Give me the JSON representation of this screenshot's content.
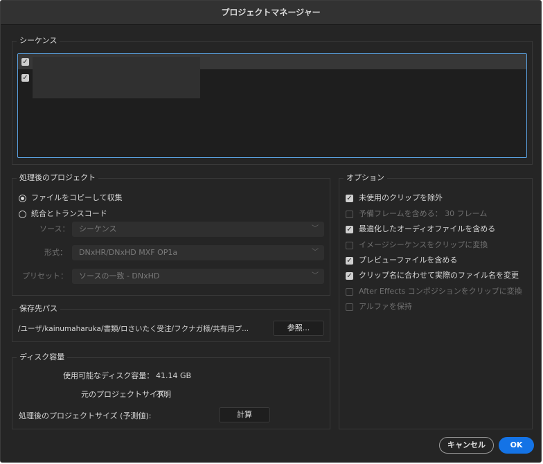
{
  "dialog": {
    "title": "プロジェクトマネージャー"
  },
  "sequences": {
    "title": "シーケンス",
    "items": [
      {
        "checked": true,
        "name": ""
      },
      {
        "checked": true,
        "name": ""
      }
    ]
  },
  "resulting_project": {
    "title": "処理後のプロジェクト",
    "options": [
      {
        "label": "ファイルをコピーして収集",
        "selected": true
      },
      {
        "label": "統合とトランスコード",
        "selected": false
      }
    ],
    "source_label": "ソース：",
    "source_value": "シーケンス",
    "format_label": "形式：",
    "format_value": "DNxHR/DNxHD MXF OP1a",
    "preset_label": "プリセット：",
    "preset_value": "ソースの一致 - DNxHD"
  },
  "destination": {
    "title": "保存先パス",
    "path": "/ユーザ/kainumaharuka/書類/ロさいたく受注/フクナガ様/共有用プ...",
    "browse_label": "参照..."
  },
  "disk_space": {
    "title": "ディスク容量",
    "available_label": "使用可能なディスク容量：",
    "available_value": "41.14 GB",
    "original_size_label": "元のプロジェクトサイズ：",
    "original_size_value": "不明",
    "resulting_size_label": "処理後のプロジェクトサイズ (予測値):",
    "calculate_label": "計算"
  },
  "options": {
    "title": "オプション",
    "items": [
      {
        "label": "未使用のクリップを除外",
        "checked": true,
        "enabled": true
      },
      {
        "label": "予備フレームを含める：  30 フレーム",
        "checked": false,
        "enabled": false
      },
      {
        "label": "最適化したオーディオファイルを含める",
        "checked": true,
        "enabled": true
      },
      {
        "label": "イメージシーケンスをクリップに変換",
        "checked": false,
        "enabled": false
      },
      {
        "label": "プレビューファイルを含める",
        "checked": true,
        "enabled": true
      },
      {
        "label": "クリップ名に合わせて実際のファイル名を変更",
        "checked": true,
        "enabled": true
      },
      {
        "label": "After Effects コンポジションをクリップに変換",
        "checked": false,
        "enabled": false
      },
      {
        "label": "アルファを保持",
        "checked": false,
        "enabled": false
      }
    ]
  },
  "footer": {
    "cancel_label": "キャンセル",
    "ok_label": "OK"
  },
  "colors": {
    "accent": "#1473e6",
    "background": "#252525",
    "focus_border": "#5aa1e0"
  }
}
